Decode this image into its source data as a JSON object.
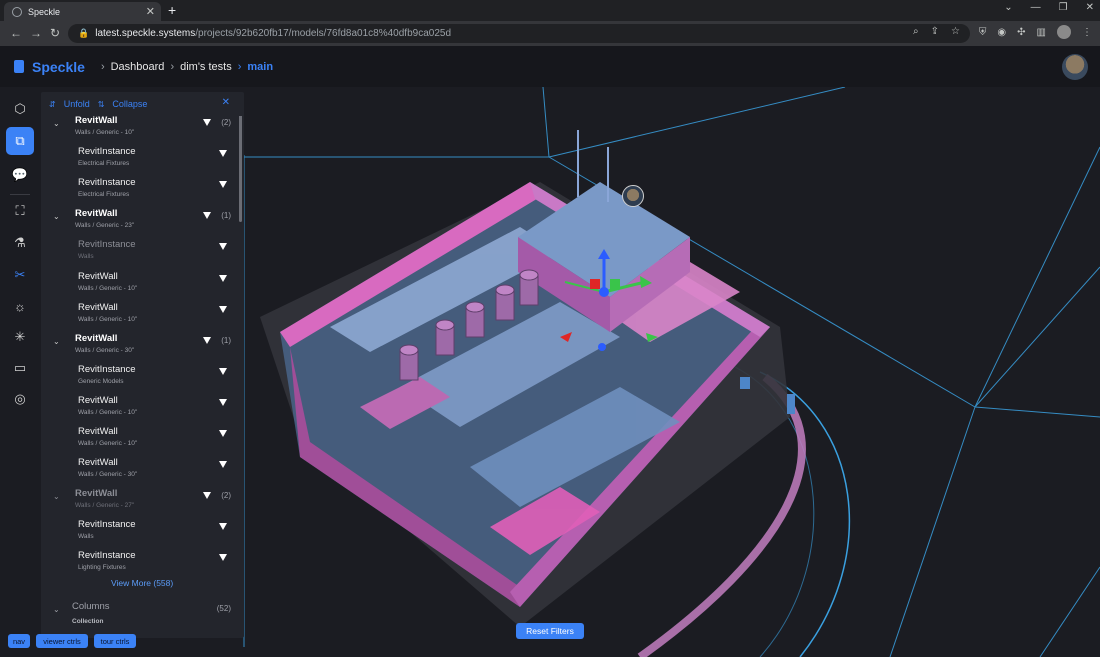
{
  "browser": {
    "tab_title": "Speckle",
    "url_host": "latest.speckle.systems",
    "url_path": "/projects/92b620fb17/models/76fd8a01c8%40dfb9ca025d"
  },
  "header": {
    "brand": "Speckle",
    "breadcrumbs": [
      "Dashboard",
      "dim's tests",
      "main"
    ]
  },
  "panel": {
    "unfold_label": "Unfold",
    "collapse_label": "Collapse",
    "rows": [
      {
        "name": "RevitWall",
        "sub": "Walls / Generic - 10\"",
        "count": "(2)",
        "kind": "parent",
        "dim": false
      },
      {
        "name": "RevitInstance",
        "sub": "Electrical Fixtures",
        "count": "",
        "kind": "child",
        "dim": false
      },
      {
        "name": "RevitInstance",
        "sub": "Electrical Fixtures",
        "count": "",
        "kind": "child",
        "dim": false
      },
      {
        "name": "RevitWall",
        "sub": "Walls / Generic - 23\"",
        "count": "(1)",
        "kind": "parent",
        "dim": false
      },
      {
        "name": "RevitInstance",
        "sub": "Walls",
        "count": "",
        "kind": "child",
        "dim": true
      },
      {
        "name": "RevitWall",
        "sub": "Walls / Generic - 10\"",
        "count": "",
        "kind": "child",
        "dim": false
      },
      {
        "name": "RevitWall",
        "sub": "Walls / Generic - 10\"",
        "count": "",
        "kind": "child",
        "dim": false
      },
      {
        "name": "RevitWall",
        "sub": "Walls / Generic - 30\"",
        "count": "(1)",
        "kind": "parent",
        "dim": false
      },
      {
        "name": "RevitInstance",
        "sub": "Generic Models",
        "count": "",
        "kind": "child",
        "dim": false
      },
      {
        "name": "RevitWall",
        "sub": "Walls / Generic - 10\"",
        "count": "",
        "kind": "child",
        "dim": false
      },
      {
        "name": "RevitWall",
        "sub": "Walls / Generic - 10\"",
        "count": "",
        "kind": "child",
        "dim": false
      },
      {
        "name": "RevitWall",
        "sub": "Walls / Generic - 30\"",
        "count": "",
        "kind": "child",
        "dim": false
      },
      {
        "name": "RevitWall",
        "sub": "Walls / Generic - 27\"",
        "count": "(2)",
        "kind": "parent",
        "dim": true
      },
      {
        "name": "RevitInstance",
        "sub": "Walls",
        "count": "",
        "kind": "child",
        "dim": false
      },
      {
        "name": "RevitInstance",
        "sub": "Lighting Fixtures",
        "count": "",
        "kind": "child",
        "dim": false
      }
    ],
    "view_more": "View More (558)",
    "collection": {
      "name": "Columns",
      "sub": "Collection",
      "count": "(52)"
    }
  },
  "viewer": {
    "reset_filters": "Reset Filters"
  },
  "dev_buttons": [
    "nav",
    "viewer ctrls",
    "tour ctrls"
  ],
  "rail_icons": [
    "cube-icon",
    "model-tree-icon",
    "comments-icon",
    "fullscreen-icon",
    "explode-icon",
    "section-icon",
    "light-icon",
    "sun-icon",
    "video-icon",
    "settings-icon"
  ],
  "colors": {
    "accent": "#3b82f6",
    "wall_pink": "#d94fb0",
    "wall_blue": "#5a8ec8",
    "grid_line": "#3aa0e0"
  }
}
